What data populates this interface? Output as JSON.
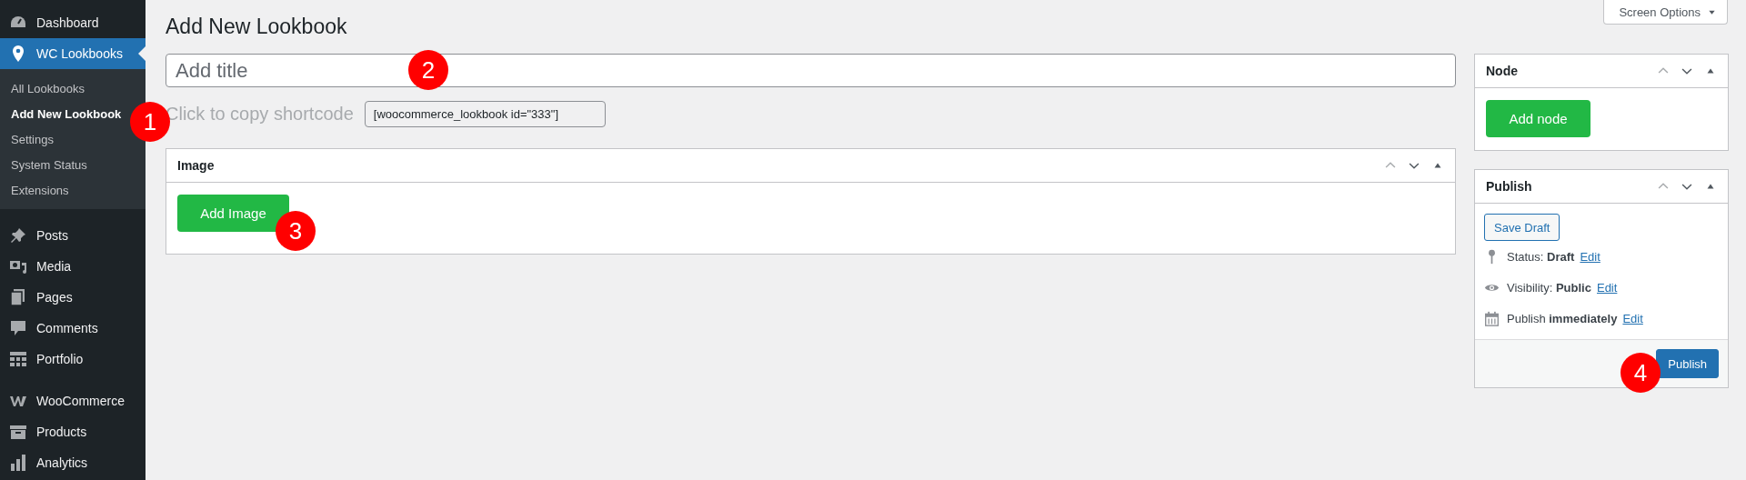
{
  "sidebar": {
    "groups": [
      {
        "items": [
          {
            "label": "Dashboard",
            "selected": false
          },
          {
            "label": "WC Lookbooks",
            "selected": true,
            "children": [
              {
                "label": "All Lookbooks",
                "selected": false
              },
              {
                "label": "Add New Lookbook",
                "selected": true
              },
              {
                "label": "Settings",
                "selected": false
              },
              {
                "label": "System Status",
                "selected": false
              },
              {
                "label": "Extensions",
                "selected": false
              }
            ]
          }
        ]
      },
      {
        "items": [
          {
            "label": "Posts",
            "selected": false
          },
          {
            "label": "Media",
            "selected": false
          },
          {
            "label": "Pages",
            "selected": false
          },
          {
            "label": "Comments",
            "selected": false
          },
          {
            "label": "Portfolio",
            "selected": false
          }
        ]
      },
      {
        "items": [
          {
            "label": "WooCommerce",
            "selected": false
          },
          {
            "label": "Products",
            "selected": false
          },
          {
            "label": "Analytics",
            "selected": false
          }
        ]
      }
    ]
  },
  "screen_options": {
    "label": "Screen Options"
  },
  "page_title": "Add New Lookbook",
  "title_field": {
    "placeholder": "Add title"
  },
  "shortcode": {
    "label": "Click to copy shortcode",
    "value": "[woocommerce_lookbook id=\"333\"]"
  },
  "image_box": {
    "title": "Image",
    "button": "Add Image"
  },
  "node_box": {
    "title": "Node",
    "button": "Add node"
  },
  "publish_box": {
    "title": "Publish",
    "save_draft": "Save Draft",
    "rows": [
      {
        "label": "Status:",
        "value": "Draft",
        "link": "Edit"
      },
      {
        "label": "Visibility:",
        "value": "Public",
        "link": "Edit"
      },
      {
        "label": "Publish",
        "value": "immediately",
        "link": "Edit"
      }
    ],
    "publish_button": "Publish"
  },
  "annotations": [
    {
      "label": "1"
    },
    {
      "label": "2"
    },
    {
      "label": "3"
    },
    {
      "label": "4"
    }
  ]
}
